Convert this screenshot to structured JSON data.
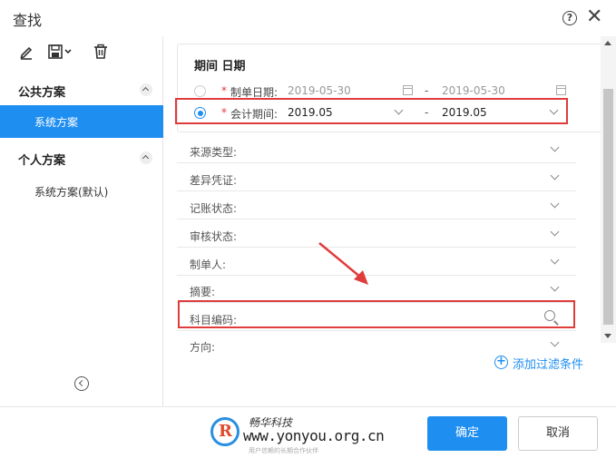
{
  "dialog": {
    "title": "查找",
    "help_icon_glyph": "?",
    "close_icon_glyph": "✕"
  },
  "toolbar": {
    "icons": [
      "edit-icon",
      "save-dropdown-icon",
      "delete-icon"
    ]
  },
  "sidebar": {
    "public_group": {
      "label": "公共方案",
      "items": [
        {
          "label": "系统方案",
          "active": true
        }
      ]
    },
    "personal_group": {
      "label": "个人方案",
      "items": [
        {
          "label": "系统方案(默认)",
          "active": false
        }
      ]
    }
  },
  "period": {
    "title": "期间 日期",
    "doc_date": {
      "required_mark": "*",
      "label": "制单日期:",
      "from": "2019-05-30",
      "to": "2019-05-30",
      "selected": false
    },
    "acct_period": {
      "required_mark": "*",
      "label": "会计期间:",
      "from": "2019.05",
      "to": "2019.05",
      "selected": true
    },
    "separator": "-"
  },
  "filters": [
    {
      "label": "来源类型:",
      "control": "dropdown"
    },
    {
      "label": "差异凭证:",
      "control": "dropdown"
    },
    {
      "label": "记账状态:",
      "control": "dropdown"
    },
    {
      "label": "审核状态:",
      "control": "dropdown"
    },
    {
      "label": "制单人:",
      "control": "dropdown"
    },
    {
      "label": "摘要:",
      "control": "dropdown"
    },
    {
      "label": "科目编码:",
      "control": "search"
    },
    {
      "label": "方向:",
      "control": "dropdown"
    }
  ],
  "add_filter": {
    "plus": "+",
    "label": "添加过滤条件"
  },
  "footer": {
    "confirm_label": "确定",
    "cancel_label": "取消",
    "watermark": {
      "brand_cn": "畅华科技",
      "url": "www.yonyou.org.cn",
      "tagline": "用户信赖的长期合作伙伴"
    }
  },
  "colors": {
    "accent": "#1f8ef1",
    "highlight": "#e03c3c",
    "required": "#ee3333"
  }
}
